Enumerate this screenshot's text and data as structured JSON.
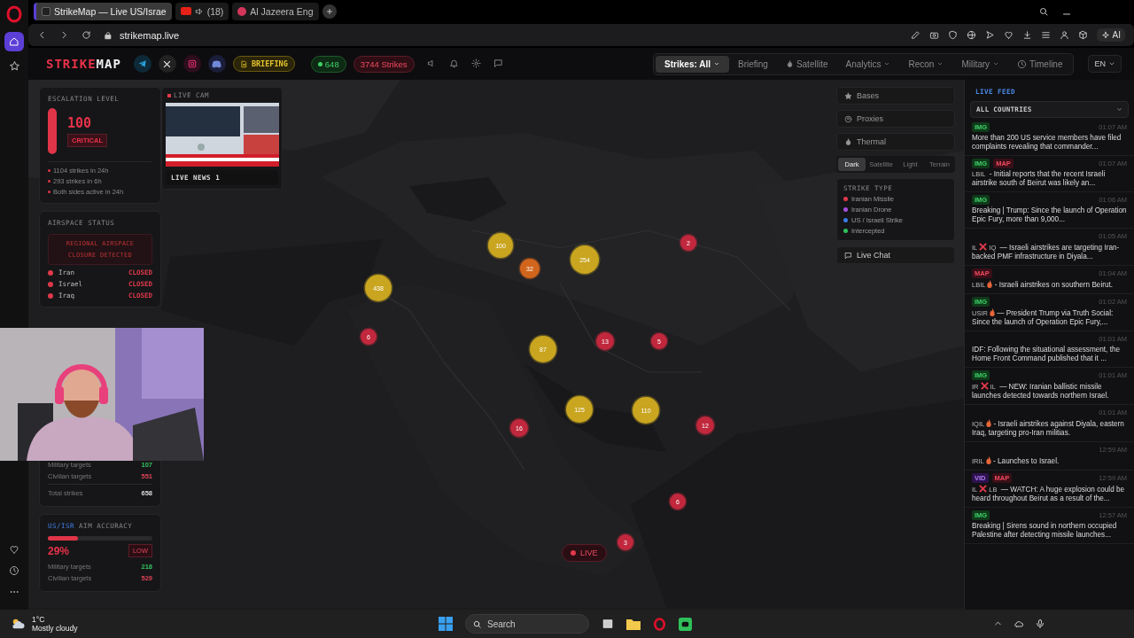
{
  "browser": {
    "tabs": [
      {
        "title": "StrikeMap — Live US/Israe",
        "selected": true
      },
      {
        "title": "(18)",
        "selected": false
      },
      {
        "title": "Al Jazeera Eng",
        "selected": false
      }
    ],
    "address": "strikemap.live",
    "ai_label": "AI"
  },
  "header": {
    "logo": {
      "accent": "STRIKE",
      "rest": "MAP"
    },
    "briefing": "BRIEFING",
    "online": "648",
    "strikes": "3744 Strikes",
    "nav": [
      {
        "label": "Strikes: All",
        "selected": true,
        "dropdown": true
      },
      {
        "label": "Briefing",
        "selected": false,
        "dropdown": false
      },
      {
        "label": "Satellite",
        "selected": false,
        "dropdown": false
      },
      {
        "label": "Analytics",
        "selected": false,
        "dropdown": true
      },
      {
        "label": "Recon",
        "selected": false,
        "dropdown": true
      },
      {
        "label": "Military",
        "selected": false,
        "dropdown": true
      },
      {
        "label": "Timeline",
        "selected": false,
        "dropdown": false
      }
    ],
    "language": "EN"
  },
  "escalation": {
    "title": "ESCALATION LEVEL",
    "level": 1,
    "value": "100",
    "status": "CRITICAL",
    "facts": [
      "1104 strikes in 24h",
      "293 strikes in 6h",
      "Both sides active in 24h"
    ]
  },
  "airspace": {
    "title": "AIRSPACE STATUS",
    "alert": "REGIONAL AIRSPACE CLOSURE DETECTED",
    "countries": [
      {
        "name": "Iran",
        "status": "CLOSED"
      },
      {
        "name": "Israel",
        "status": "CLOSED"
      },
      {
        "name": "Iraq",
        "status": "CLOSED"
      }
    ]
  },
  "targets": {
    "rows": [
      {
        "label": "Military targets",
        "value": "107",
        "kind": "military"
      },
      {
        "label": "Civilian targets",
        "value": "551",
        "kind": "civilian"
      },
      {
        "label": "Total strikes",
        "value": "658",
        "kind": "total"
      }
    ]
  },
  "accuracy": {
    "side": "US/ISR",
    "title": "AIM ACCURACY",
    "level": 0.29,
    "value": "29%",
    "rating": "LOW",
    "rows": [
      {
        "label": "Military targets",
        "value": "218",
        "kind": "military"
      },
      {
        "label": "Civilian targets",
        "value": "529",
        "kind": "civilian"
      }
    ]
  },
  "live_cam": {
    "title": "LIVE CAM",
    "channel": "LIVE NEWS 1"
  },
  "layers": [
    "Bases",
    "Proxies",
    "Thermal"
  ],
  "map_styles": [
    {
      "label": "Dark",
      "selected": true
    },
    {
      "label": "Satellite",
      "selected": false
    },
    {
      "label": "Light",
      "selected": false
    },
    {
      "label": "Terrain",
      "selected": false
    }
  ],
  "legend": {
    "title": "STRIKE TYPE",
    "items": [
      {
        "label": "Iranian Missile",
        "color": "#e0394a"
      },
      {
        "label": "Iranian Drone",
        "color": "#a64ee0"
      },
      {
        "label": "US / Israeli Strike",
        "color": "#3b7be8"
      },
      {
        "label": "Intercepted",
        "color": "#2fc05a"
      }
    ]
  },
  "live_chat": "Live Chat",
  "live_button": "LIVE",
  "clusters": [
    {
      "count": "100",
      "color": "#c9a520"
    },
    {
      "count": "32",
      "color": "#d2651c"
    },
    {
      "count": "254",
      "color": "#c9a520"
    },
    {
      "count": "438",
      "color": "#c9a520"
    },
    {
      "count": "2",
      "color": "#c1283d"
    },
    {
      "count": "6",
      "color": "#c1283d"
    },
    {
      "count": "87",
      "color": "#c9a520"
    },
    {
      "count": "13",
      "color": "#c1283d"
    },
    {
      "count": "5",
      "color": "#c1283d"
    },
    {
      "count": "125",
      "color": "#c9a520"
    },
    {
      "count": "110",
      "color": "#c9a520"
    },
    {
      "count": "12",
      "color": "#c1283d"
    },
    {
      "count": "16",
      "color": "#c1283d"
    },
    {
      "count": "6",
      "color": "#c1283d"
    },
    {
      "count": "3",
      "color": "#c1283d"
    }
  ],
  "feed": {
    "title": "LIVE FEED",
    "filter": "ALL COUNTRIES",
    "items": [
      {
        "kind": "plain",
        "tags": [
          "IMG"
        ],
        "time": "01:07 AM",
        "text": "More than 200 US service members have filed complaints revealing that commander..."
      },
      {
        "kind": "plain",
        "tags": [
          "IMG",
          "MAP"
        ],
        "time": "01:07 AM",
        "codes": "LBIL",
        "text": "- Initial reports that the recent Israeli airstrike south of Beirut was likely an..."
      },
      {
        "kind": "plain",
        "tags": [
          "IMG"
        ],
        "time": "01:06 AM",
        "text": "Breaking | Trump: Since the launch of Operation Epic Fury, more than 9,000..."
      },
      {
        "kind": "versus",
        "time": "01:05 AM",
        "codes": "IL",
        "codes_after": "IQ",
        "text": "— Israeli airstrikes are targeting Iran-backed PMF infrastructure in Diyala..."
      },
      {
        "kind": "flame",
        "tags": [
          "MAP"
        ],
        "time": "01:04 AM",
        "codes": "LBIL",
        "text": "- Israeli airstrikes on southern Beirut."
      },
      {
        "kind": "flame",
        "tags": [
          "IMG"
        ],
        "time": "01:02 AM",
        "codes": "USIR",
        "text": "— President Trump via Truth Social: Since the launch of Operation Epic Fury,..."
      },
      {
        "kind": "plain",
        "time": "01:01 AM",
        "text": "IDF: Following the situational assessment, the Home Front Command published that it ..."
      },
      {
        "kind": "versus",
        "tags": [
          "IMG"
        ],
        "time": "01:01 AM",
        "codes": "IR",
        "codes_after": "IL",
        "text": "— NEW: Iranian ballistic missile launches detected towards northern Israel."
      },
      {
        "kind": "flame",
        "time": "01:01 AM",
        "codes": "IQIL",
        "text": "- Israeli airstrikes against Diyala, eastern Iraq, targeting pro-Iran militias."
      },
      {
        "kind": "flame",
        "time": "12:59 AM",
        "codes": "IRIL",
        "text": "- Launches to Israel."
      },
      {
        "kind": "versus",
        "tags": [
          "VID",
          "MAP"
        ],
        "time": "12:59 AM",
        "codes": "IL",
        "codes_after": "LB",
        "text": "— WATCH: A huge explosion could be heard throughout Beirut as a result of the..."
      },
      {
        "kind": "plain",
        "tags": [
          "IMG"
        ],
        "time": "12:57 AM",
        "text": "Breaking | Sirens sound in northern occupied Palestine after detecting missile launches..."
      }
    ]
  },
  "taskbar": {
    "temperature": "1°C",
    "weather": "Mostly cloudy",
    "search_placeholder": "Search"
  }
}
